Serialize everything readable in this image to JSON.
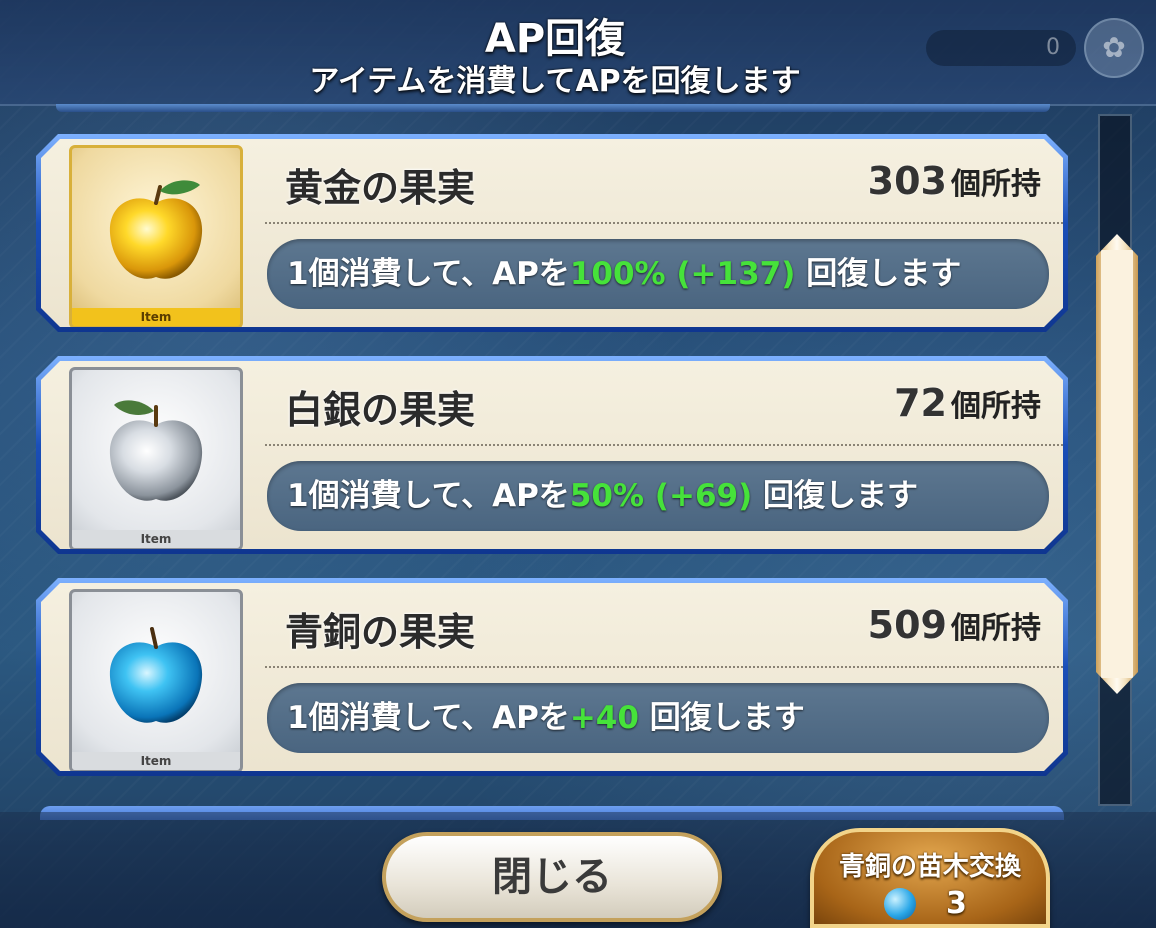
{
  "header": {
    "title": "AP回復",
    "subtitle": "アイテムを消費してAPを回復します",
    "counter": "0"
  },
  "items": [
    {
      "name": "黄金の果実",
      "count": "303",
      "count_unit": "個所持",
      "tag": "Item",
      "desc_prefix": "1個消費して、APを",
      "desc_highlight": "100% (+137)",
      "desc_suffix": " 回復します",
      "frame": "gold",
      "icon": "golden-apple-icon"
    },
    {
      "name": "白銀の果実",
      "count": "72",
      "count_unit": "個所持",
      "tag": "Item",
      "desc_prefix": "1個消費して、APを",
      "desc_highlight": "50% (+69)",
      "desc_suffix": " 回復します",
      "frame": "silver",
      "icon": "silver-apple-icon"
    },
    {
      "name": "青銅の果実",
      "count": "509",
      "count_unit": "個所持",
      "tag": "Item",
      "desc_prefix": "1個消費して、APを",
      "desc_highlight": "+40",
      "desc_suffix": " 回復します",
      "frame": "bronze",
      "icon": "bronze-apple-icon"
    }
  ],
  "footer": {
    "close_label": "閉じる",
    "exchange_label": "青銅の苗木交換",
    "exchange_count": "3"
  },
  "colors": {
    "highlight": "#46e23a",
    "card_border": "#1a4fb8",
    "gold": "#f2c21c"
  }
}
